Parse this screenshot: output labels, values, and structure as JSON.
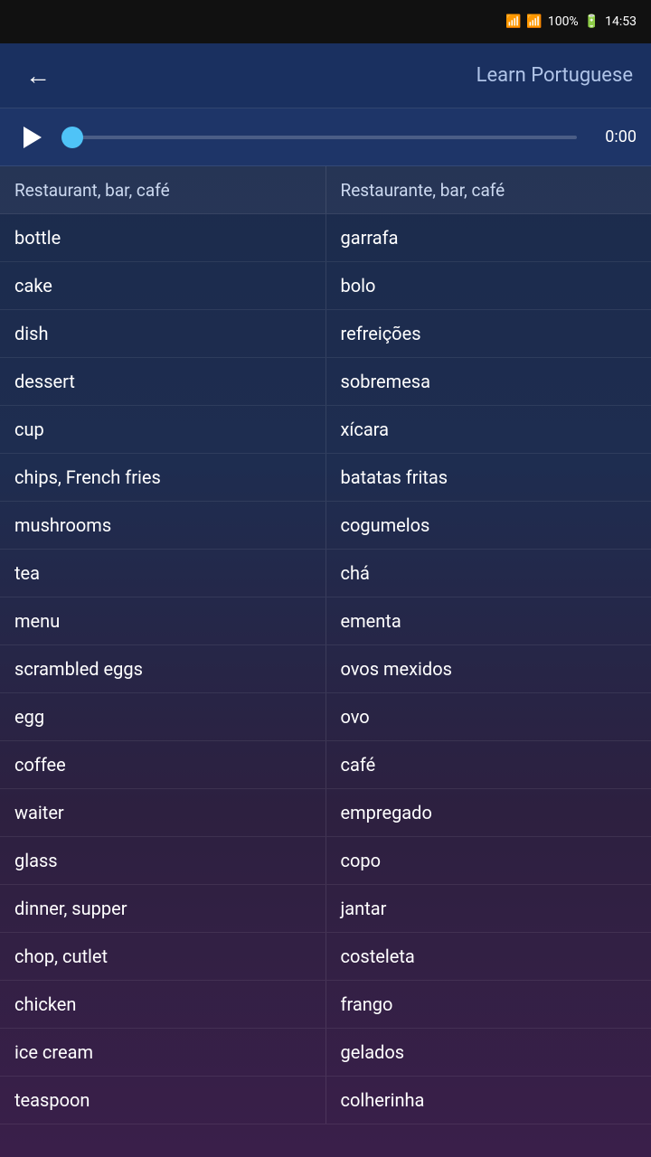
{
  "statusBar": {
    "battery": "100%",
    "time": "14:53"
  },
  "header": {
    "title": "Learn Portuguese",
    "backLabel": "←"
  },
  "audioPlayer": {
    "time": "0:00"
  },
  "vocab": [
    {
      "english": "Restaurant, bar, café",
      "portuguese": "Restaurante, bar, café",
      "isHeader": true
    },
    {
      "english": "bottle",
      "portuguese": "garrafa"
    },
    {
      "english": "cake",
      "portuguese": "bolo"
    },
    {
      "english": "dish",
      "portuguese": "refreições"
    },
    {
      "english": "dessert",
      "portuguese": "sobremesa"
    },
    {
      "english": "cup",
      "portuguese": "xícara"
    },
    {
      "english": "chips, French fries",
      "portuguese": "batatas fritas"
    },
    {
      "english": "mushrooms",
      "portuguese": "cogumelos"
    },
    {
      "english": "tea",
      "portuguese": "chá"
    },
    {
      "english": "menu",
      "portuguese": "ementa"
    },
    {
      "english": "scrambled eggs",
      "portuguese": "ovos mexidos"
    },
    {
      "english": "egg",
      "portuguese": "ovo"
    },
    {
      "english": "coffee",
      "portuguese": "café"
    },
    {
      "english": "waiter",
      "portuguese": "empregado"
    },
    {
      "english": "glass",
      "portuguese": "copo"
    },
    {
      "english": "dinner, supper",
      "portuguese": "jantar"
    },
    {
      "english": "chop, cutlet",
      "portuguese": "costeleta"
    },
    {
      "english": "chicken",
      "portuguese": "frango"
    },
    {
      "english": "ice cream",
      "portuguese": "gelados"
    },
    {
      "english": "teaspoon",
      "portuguese": "colherinha"
    }
  ]
}
